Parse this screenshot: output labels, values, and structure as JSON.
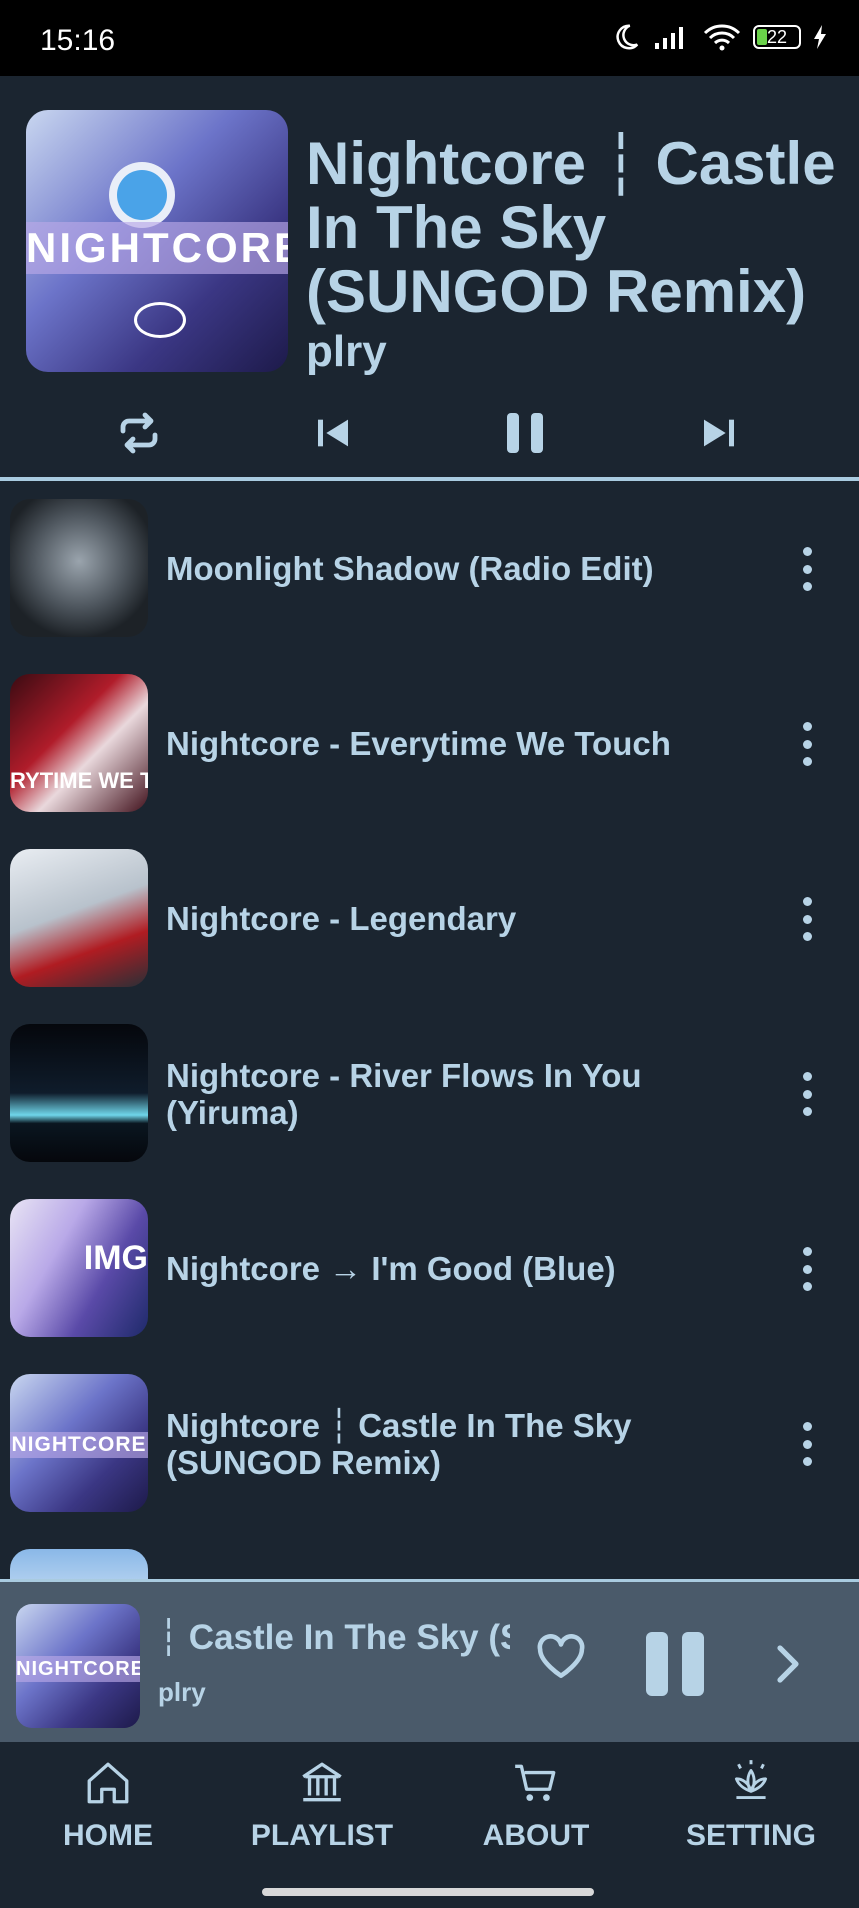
{
  "status": {
    "time": "15:16",
    "battery": "22"
  },
  "now_playing": {
    "title": "Nightcore ┆ Castle In The Sky (SUNGOD Remix)",
    "artist": "plry",
    "cover_text": "NIGHTCORE"
  },
  "controls": [
    "repeat-icon",
    "previous-icon",
    "pause-icon",
    "next-icon"
  ],
  "tracks": [
    {
      "title": "Moonlight Shadow (Radio Edit)"
    },
    {
      "title": "Nightcore - Everytime We Touch",
      "thumb_text": "RYTIME WE TO"
    },
    {
      "title": "Nightcore - Legendary"
    },
    {
      "title": "Nightcore - River Flows In You (Yiruma)"
    },
    {
      "title": "Nightcore → I'm Good (Blue)",
      "thumb_text": "IMG"
    },
    {
      "title": "Nightcore ┆ Castle In The Sky (SUNGOD Remix)",
      "thumb_text": "NIGHTCORE"
    }
  ],
  "mini_player": {
    "title": "┆ Castle In The Sky (S",
    "artist": "plry",
    "thumb_text": "NIGHTCORE"
  },
  "nav": {
    "home": "HOME",
    "playlist": "PLAYLIST",
    "about": "ABOUT",
    "setting": "SETTING"
  },
  "colors": {
    "background": "#1b2530",
    "accent": "#b7d3e6",
    "mini_player_bg": "#4a5a6a"
  }
}
